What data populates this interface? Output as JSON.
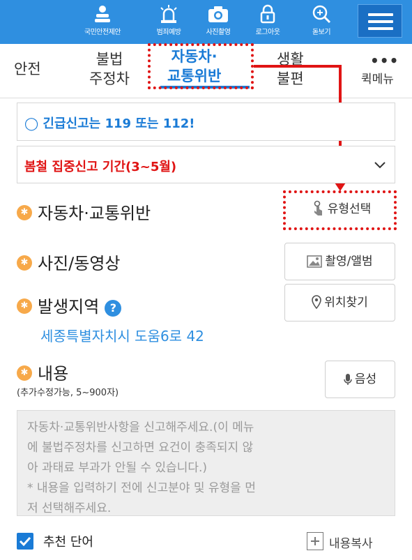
{
  "topbar": {
    "items": [
      {
        "label": "국민안전제안",
        "icon": "safety-proposal-icon"
      },
      {
        "label": "범죄예방",
        "icon": "siren-icon"
      },
      {
        "label": "사진촬영",
        "icon": "camera-icon"
      },
      {
        "label": "로그아웃",
        "icon": "lock-icon"
      },
      {
        "label": "돋보기",
        "icon": "magnifier-icon"
      }
    ],
    "menu_icon": "hamburger-menu-icon"
  },
  "tabs": {
    "items": [
      {
        "label": "안전"
      },
      {
        "label": "불법\n주정차"
      },
      {
        "label": "자동차·\n교통위반"
      },
      {
        "label": "생활\n불편"
      }
    ],
    "quick_menu": {
      "dots": "•••",
      "label": "퀵메뉴"
    },
    "active_index": 2
  },
  "notices": {
    "emergency": "◯ 긴급신고는 119 또는 112!",
    "period": "봄철 집중신고 기간(3~5월)"
  },
  "form": {
    "category": {
      "label": "자동차·교통위반",
      "button": "유형선택"
    },
    "media": {
      "label": "사진/동영상",
      "button": "촬영/앨범"
    },
    "location": {
      "label": "발생지역",
      "help": "?",
      "button": "위치찾기",
      "address": "세종특별자치시 도움6로 42"
    },
    "content": {
      "label": "내용",
      "sublabel": "(추가수정가능, 5~900자)",
      "button": "음성",
      "placeholder": "자동차·교통위반사항을 신고해주세요.(이 메뉴\n에 불법주정차를 신고하면 요건이 충족되지 않\n아 과태료 부과가 안될 수 있습니다.)\n* 내용을 입력하기 전에 신고분야 및 유형을 먼\n저 선택해주세요."
    },
    "recommend": {
      "label": "추천 단어",
      "checked": true
    },
    "copy": {
      "label": "내용복사"
    }
  },
  "colors": {
    "brand_blue": "#2f8fe0",
    "active_tab": "#1a7bd6",
    "alert_red": "#e01414",
    "bullet_orange": "#f7a94a"
  }
}
